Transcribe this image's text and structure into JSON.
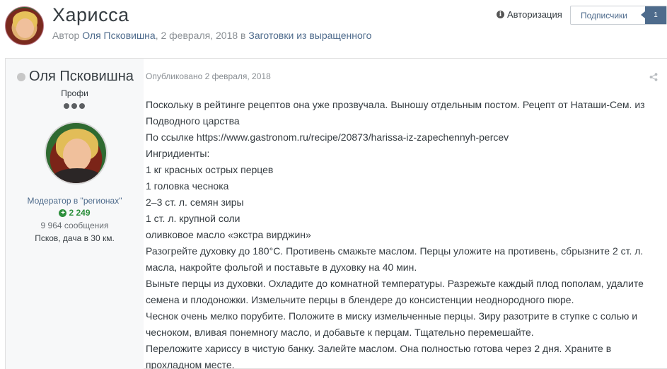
{
  "topic": {
    "title": "Харисса",
    "meta_prefix": "Автор ",
    "author": "Оля Псковишна",
    "meta_date": ", 2 февраля, 2018 в ",
    "forum": "Заготовки из выращенного"
  },
  "header_actions": {
    "auth_label": "Авторизация",
    "follow_label": "Подписчики",
    "follow_count": "1"
  },
  "post": {
    "author_name": "Оля Псковишна",
    "author_rank": "Профи",
    "author_group": "Модератор в \"регионах\"",
    "reputation": "2 249",
    "posts_count": "9 964 сообщения",
    "location": "Псков, дача в 30 км.",
    "published": "Опубликовано 2 февраля, 2018",
    "body_lines": [
      "Поскольку в рейтинге рецептов она уже прозвучала. Выношу отдельным постом. Рецепт от Наташи-Сем. из Подводного царства",
      "По ссылке https://www.gastronom.ru/recipe/20873/harissa-iz-zapechennyh-percev",
      "Ингридиенты:",
      "1 кг красных острых перцев",
      "1 головка чеснока",
      "2–3 ст. л. семян зиры",
      "1 ст. л. крупной соли",
      "оливковое масло «экстра вирджин»",
      "Разогрейте духовку до 180°С. Противень смажьте маслом. Перцы уложите на противень, сбрызните 2 ст. л. масла, накройте фольгой и поставьте в духовку на 40 мин.",
      "Выньте перцы из духовки. Охладите до комнатной температуры. Разрежьте каждый плод пополам, удалите семена и плодоножки. Измельчите перцы в блендере до консистенции неоднородного пюре.",
      "Чеснок очень мелко порубите. Положите в миску измельченные перцы. Зиру разотрите в ступке с солью и чесноком, вливая понемногу масло, и добавьте к перцам. Тщательно перемешайте.",
      "Переложите хариссу в чистую банку. Залейте маслом. Она полностью готова через 2 дня. Храните в прохладном месте."
    ]
  },
  "icons": {
    "info": "info-icon",
    "share": "share-icon",
    "online_status": "online-dot",
    "reputation": "plus-icon"
  },
  "colors": {
    "link": "#4e6b8c",
    "follow_count_bg": "#4e6b8c",
    "reputation": "#2d8f3c",
    "author_col_bg": "#f7f8f9"
  }
}
